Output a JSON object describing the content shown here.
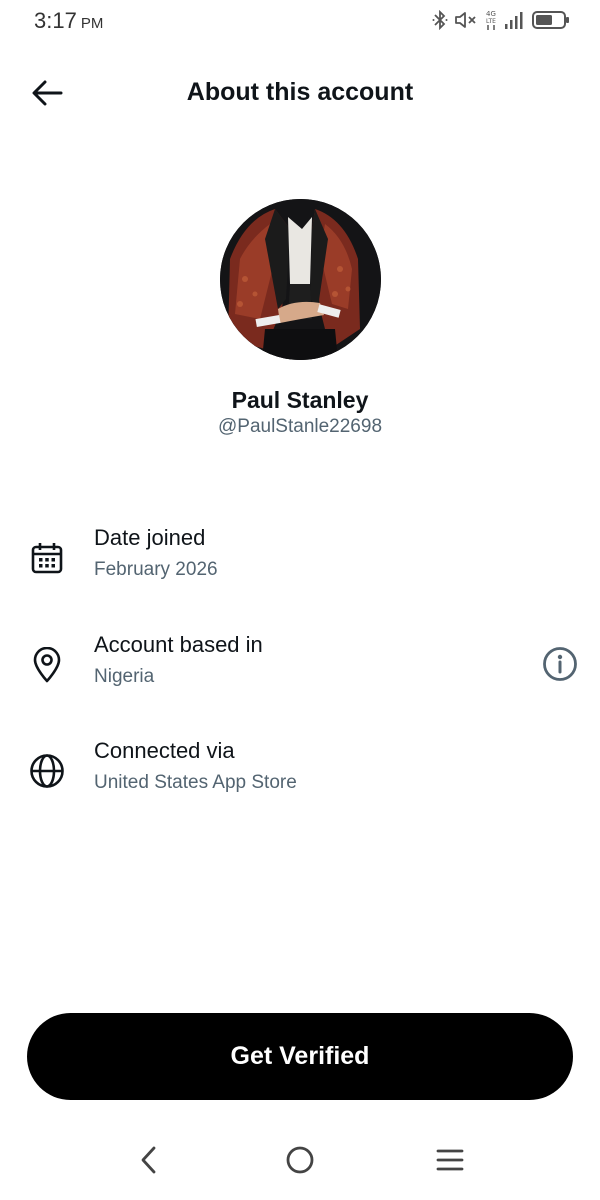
{
  "status_bar": {
    "time": "3:17",
    "ampm": "PM",
    "network": "4G LTE",
    "icons": [
      "bluetooth-icon",
      "mute-icon",
      "network-4g-lte-icon",
      "signal-icon",
      "battery-icon"
    ]
  },
  "header": {
    "title": "About this account",
    "back_icon": "arrow-left-icon"
  },
  "profile": {
    "name": "Paul Stanley",
    "handle": "@PaulStanle22698"
  },
  "info": {
    "joined": {
      "label": "Date joined",
      "value": "February 2026",
      "icon": "calendar-icon"
    },
    "based_in": {
      "label": "Account based in",
      "value": "Nigeria",
      "icon": "location-pin-icon",
      "action_icon": "info-icon"
    },
    "connected_via": {
      "label": "Connected via",
      "value": "United States App Store",
      "icon": "globe-icon"
    }
  },
  "cta": {
    "label": "Get Verified"
  },
  "nav": {
    "icons": [
      "back-chevron-icon",
      "home-circle-icon",
      "recents-menu-icon"
    ]
  },
  "colors": {
    "primary_text": "#0f1419",
    "secondary_text": "#536471",
    "button_bg": "#000000",
    "button_text": "#ffffff"
  }
}
